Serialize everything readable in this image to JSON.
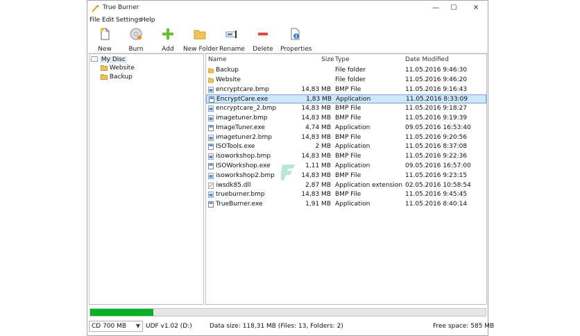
{
  "window": {
    "title": "True Burner"
  },
  "window_controls": {
    "minimize": "—",
    "maximize": "☐",
    "close": "✕"
  },
  "menu": [
    "File",
    "Edit",
    "Settings",
    "Help"
  ],
  "toolbar": {
    "new": "New",
    "burn": "Burn",
    "add": "Add",
    "new_folder": "New Folder",
    "rename": "Rename",
    "delete": "Delete",
    "properties": "Properties"
  },
  "tree": {
    "root": "My Disc",
    "children": [
      "Website",
      "Backup"
    ]
  },
  "columns": {
    "name": "Name",
    "size": "Size",
    "type": "Type",
    "date": "Date Modified"
  },
  "files": [
    {
      "name": "Backup",
      "size": "",
      "type": "File folder",
      "date": "11.05.2016 9:46:30",
      "kind": "folder"
    },
    {
      "name": "Website",
      "size": "",
      "type": "File folder",
      "date": "11.05.2016 9:46:20",
      "kind": "folder"
    },
    {
      "name": "encryptcare.bmp",
      "size": "14,83 MB",
      "type": "BMP File",
      "date": "11.05.2016 9:16:43",
      "kind": "bmp"
    },
    {
      "name": "EncryptCare.exe",
      "size": "1,83 MB",
      "type": "Application",
      "date": "11.05.2016 8:33:09",
      "kind": "exe"
    },
    {
      "name": "encryptcare_2.bmp",
      "size": "14,83 MB",
      "type": "BMP File",
      "date": "11.05.2016 9:18:27",
      "kind": "bmp"
    },
    {
      "name": "imagetuner.bmp",
      "size": "14,83 MB",
      "type": "BMP File",
      "date": "11.05.2016 9:19:39",
      "kind": "bmp"
    },
    {
      "name": "ImageTuner.exe",
      "size": "4,74 MB",
      "type": "Application",
      "date": "09.05.2016 16:53:40",
      "kind": "exe"
    },
    {
      "name": "imagetuner2.bmp",
      "size": "14,83 MB",
      "type": "BMP File",
      "date": "11.05.2016 9:20:56",
      "kind": "bmp"
    },
    {
      "name": "ISOTools.exe",
      "size": "2 MB",
      "type": "Application",
      "date": "11.05.2016 8:37:08",
      "kind": "exe"
    },
    {
      "name": "isoworkshop.bmp",
      "size": "14,83 MB",
      "type": "BMP File",
      "date": "11.05.2016 9:22:36",
      "kind": "bmp"
    },
    {
      "name": "ISOWorkshop.exe",
      "size": "1,11 MB",
      "type": "Application",
      "date": "09.05.2016 16:57:00",
      "kind": "exe"
    },
    {
      "name": "isoworkshop2.bmp",
      "size": "14,83 MB",
      "type": "BMP File",
      "date": "11.05.2016 9:23:15",
      "kind": "bmp"
    },
    {
      "name": "iwsdk85.dll",
      "size": "2,87 MB",
      "type": "Application extension",
      "date": "02.05.2016 10:58:54",
      "kind": "dll"
    },
    {
      "name": "trueburner.bmp",
      "size": "14,83 MB",
      "type": "BMP File",
      "date": "11.05.2016 9:45:45",
      "kind": "bmp"
    },
    {
      "name": "TrueBurner.exe",
      "size": "1,91 MB",
      "type": "Application",
      "date": "11.05.2016 8:40:14",
      "kind": "exe"
    }
  ],
  "selected_index": 3,
  "progress": {
    "fraction": 0.16,
    "color": "#06b025"
  },
  "status": {
    "disc_type": "CD 700 MB",
    "filesystem": "UDF v1.02 (D:)",
    "data_size": "Data size: 118,31 MB (Files: 13, Folders: 2)",
    "free_space": "Free space: 585 MB"
  },
  "colors": {
    "selection": "#cce8ff",
    "folder": "#e8b84a",
    "accent": "#06b025"
  }
}
